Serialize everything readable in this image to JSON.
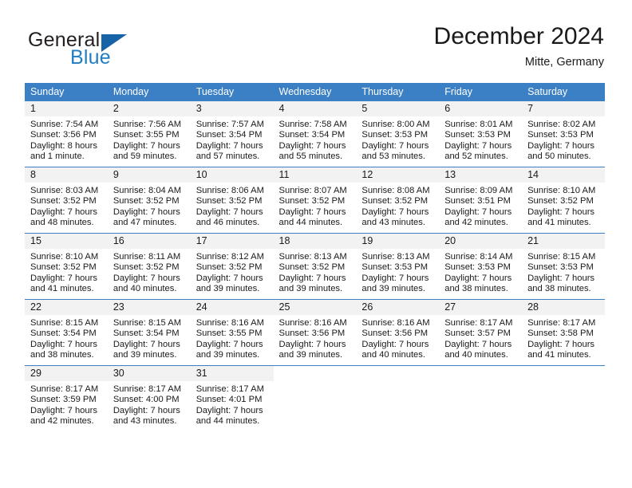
{
  "logo": {
    "word_one": "General",
    "word_two": "Blue",
    "accent_color": "#1763a8",
    "blue_text_color": "#1f7ec4"
  },
  "header": {
    "title": "December 2024",
    "location": "Mitte, Germany"
  },
  "theme": {
    "header_blue": "#3b7fc4",
    "daynum_band": "#f2f2f2",
    "text": "#1a1a1a"
  },
  "weekdays": [
    "Sunday",
    "Monday",
    "Tuesday",
    "Wednesday",
    "Thursday",
    "Friday",
    "Saturday"
  ],
  "weeks": [
    [
      {
        "day": "1",
        "sunrise": "Sunrise: 7:54 AM",
        "sunset": "Sunset: 3:56 PM",
        "daylight_1": "Daylight: 8 hours",
        "daylight_2": "and 1 minute."
      },
      {
        "day": "2",
        "sunrise": "Sunrise: 7:56 AM",
        "sunset": "Sunset: 3:55 PM",
        "daylight_1": "Daylight: 7 hours",
        "daylight_2": "and 59 minutes."
      },
      {
        "day": "3",
        "sunrise": "Sunrise: 7:57 AM",
        "sunset": "Sunset: 3:54 PM",
        "daylight_1": "Daylight: 7 hours",
        "daylight_2": "and 57 minutes."
      },
      {
        "day": "4",
        "sunrise": "Sunrise: 7:58 AM",
        "sunset": "Sunset: 3:54 PM",
        "daylight_1": "Daylight: 7 hours",
        "daylight_2": "and 55 minutes."
      },
      {
        "day": "5",
        "sunrise": "Sunrise: 8:00 AM",
        "sunset": "Sunset: 3:53 PM",
        "daylight_1": "Daylight: 7 hours",
        "daylight_2": "and 53 minutes."
      },
      {
        "day": "6",
        "sunrise": "Sunrise: 8:01 AM",
        "sunset": "Sunset: 3:53 PM",
        "daylight_1": "Daylight: 7 hours",
        "daylight_2": "and 52 minutes."
      },
      {
        "day": "7",
        "sunrise": "Sunrise: 8:02 AM",
        "sunset": "Sunset: 3:53 PM",
        "daylight_1": "Daylight: 7 hours",
        "daylight_2": "and 50 minutes."
      }
    ],
    [
      {
        "day": "8",
        "sunrise": "Sunrise: 8:03 AM",
        "sunset": "Sunset: 3:52 PM",
        "daylight_1": "Daylight: 7 hours",
        "daylight_2": "and 48 minutes."
      },
      {
        "day": "9",
        "sunrise": "Sunrise: 8:04 AM",
        "sunset": "Sunset: 3:52 PM",
        "daylight_1": "Daylight: 7 hours",
        "daylight_2": "and 47 minutes."
      },
      {
        "day": "10",
        "sunrise": "Sunrise: 8:06 AM",
        "sunset": "Sunset: 3:52 PM",
        "daylight_1": "Daylight: 7 hours",
        "daylight_2": "and 46 minutes."
      },
      {
        "day": "11",
        "sunrise": "Sunrise: 8:07 AM",
        "sunset": "Sunset: 3:52 PM",
        "daylight_1": "Daylight: 7 hours",
        "daylight_2": "and 44 minutes."
      },
      {
        "day": "12",
        "sunrise": "Sunrise: 8:08 AM",
        "sunset": "Sunset: 3:52 PM",
        "daylight_1": "Daylight: 7 hours",
        "daylight_2": "and 43 minutes."
      },
      {
        "day": "13",
        "sunrise": "Sunrise: 8:09 AM",
        "sunset": "Sunset: 3:51 PM",
        "daylight_1": "Daylight: 7 hours",
        "daylight_2": "and 42 minutes."
      },
      {
        "day": "14",
        "sunrise": "Sunrise: 8:10 AM",
        "sunset": "Sunset: 3:52 PM",
        "daylight_1": "Daylight: 7 hours",
        "daylight_2": "and 41 minutes."
      }
    ],
    [
      {
        "day": "15",
        "sunrise": "Sunrise: 8:10 AM",
        "sunset": "Sunset: 3:52 PM",
        "daylight_1": "Daylight: 7 hours",
        "daylight_2": "and 41 minutes."
      },
      {
        "day": "16",
        "sunrise": "Sunrise: 8:11 AM",
        "sunset": "Sunset: 3:52 PM",
        "daylight_1": "Daylight: 7 hours",
        "daylight_2": "and 40 minutes."
      },
      {
        "day": "17",
        "sunrise": "Sunrise: 8:12 AM",
        "sunset": "Sunset: 3:52 PM",
        "daylight_1": "Daylight: 7 hours",
        "daylight_2": "and 39 minutes."
      },
      {
        "day": "18",
        "sunrise": "Sunrise: 8:13 AM",
        "sunset": "Sunset: 3:52 PM",
        "daylight_1": "Daylight: 7 hours",
        "daylight_2": "and 39 minutes."
      },
      {
        "day": "19",
        "sunrise": "Sunrise: 8:13 AM",
        "sunset": "Sunset: 3:53 PM",
        "daylight_1": "Daylight: 7 hours",
        "daylight_2": "and 39 minutes."
      },
      {
        "day": "20",
        "sunrise": "Sunrise: 8:14 AM",
        "sunset": "Sunset: 3:53 PM",
        "daylight_1": "Daylight: 7 hours",
        "daylight_2": "and 38 minutes."
      },
      {
        "day": "21",
        "sunrise": "Sunrise: 8:15 AM",
        "sunset": "Sunset: 3:53 PM",
        "daylight_1": "Daylight: 7 hours",
        "daylight_2": "and 38 minutes."
      }
    ],
    [
      {
        "day": "22",
        "sunrise": "Sunrise: 8:15 AM",
        "sunset": "Sunset: 3:54 PM",
        "daylight_1": "Daylight: 7 hours",
        "daylight_2": "and 38 minutes."
      },
      {
        "day": "23",
        "sunrise": "Sunrise: 8:15 AM",
        "sunset": "Sunset: 3:54 PM",
        "daylight_1": "Daylight: 7 hours",
        "daylight_2": "and 39 minutes."
      },
      {
        "day": "24",
        "sunrise": "Sunrise: 8:16 AM",
        "sunset": "Sunset: 3:55 PM",
        "daylight_1": "Daylight: 7 hours",
        "daylight_2": "and 39 minutes."
      },
      {
        "day": "25",
        "sunrise": "Sunrise: 8:16 AM",
        "sunset": "Sunset: 3:56 PM",
        "daylight_1": "Daylight: 7 hours",
        "daylight_2": "and 39 minutes."
      },
      {
        "day": "26",
        "sunrise": "Sunrise: 8:16 AM",
        "sunset": "Sunset: 3:56 PM",
        "daylight_1": "Daylight: 7 hours",
        "daylight_2": "and 40 minutes."
      },
      {
        "day": "27",
        "sunrise": "Sunrise: 8:17 AM",
        "sunset": "Sunset: 3:57 PM",
        "daylight_1": "Daylight: 7 hours",
        "daylight_2": "and 40 minutes."
      },
      {
        "day": "28",
        "sunrise": "Sunrise: 8:17 AM",
        "sunset": "Sunset: 3:58 PM",
        "daylight_1": "Daylight: 7 hours",
        "daylight_2": "and 41 minutes."
      }
    ],
    [
      {
        "day": "29",
        "sunrise": "Sunrise: 8:17 AM",
        "sunset": "Sunset: 3:59 PM",
        "daylight_1": "Daylight: 7 hours",
        "daylight_2": "and 42 minutes."
      },
      {
        "day": "30",
        "sunrise": "Sunrise: 8:17 AM",
        "sunset": "Sunset: 4:00 PM",
        "daylight_1": "Daylight: 7 hours",
        "daylight_2": "and 43 minutes."
      },
      {
        "day": "31",
        "sunrise": "Sunrise: 8:17 AM",
        "sunset": "Sunset: 4:01 PM",
        "daylight_1": "Daylight: 7 hours",
        "daylight_2": "and 44 minutes."
      },
      null,
      null,
      null,
      null
    ]
  ]
}
